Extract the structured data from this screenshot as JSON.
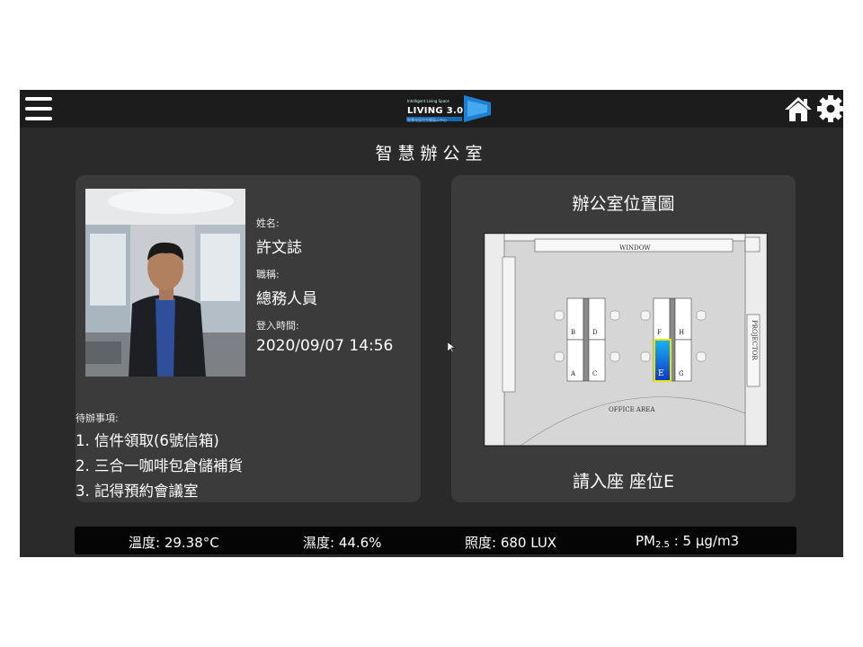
{
  "header": {
    "logo_tagline": "Intelligent Living Space",
    "logo_title": "LIVING 3.0",
    "logo_subtitle": "智慧化居住空間展示中心"
  },
  "page_title": "智慧辦公室",
  "profile": {
    "name_label": "姓名:",
    "name": "許文誌",
    "title_label": "職稱:",
    "title": "總務人員",
    "login_label": "登入時間:",
    "login_time": "2020/09/07 14:56"
  },
  "todo": {
    "heading": "待辦事項:",
    "items": [
      "1. 信件領取(6號信箱)",
      "2. 三合一咖啡包倉儲補貨",
      "3. 記得預約會議室"
    ]
  },
  "office_map": {
    "title": "辦公室位置圖",
    "window_label": "WINDOW",
    "projector_label": "PROJECTOR",
    "area_label": "OFFICE AREA",
    "seats": [
      "A",
      "B",
      "C",
      "D",
      "E",
      "F",
      "G",
      "H"
    ],
    "selected_seat": "E",
    "seat_message": "請入座 座位E"
  },
  "sensors": {
    "temperature": "溫度: 29.38°C",
    "humidity": "濕度: 44.6%",
    "illuminance": "照度: 680 LUX",
    "pm_prefix": "PM",
    "pm_sub": "2.5",
    "pm_value": ": 5 µg/m3"
  },
  "colors": {
    "app_bg": "#2a2a2a",
    "card_bg": "#3b3b3b",
    "selected_seat": "#1e5bd6",
    "selected_border": "#e6e600"
  }
}
